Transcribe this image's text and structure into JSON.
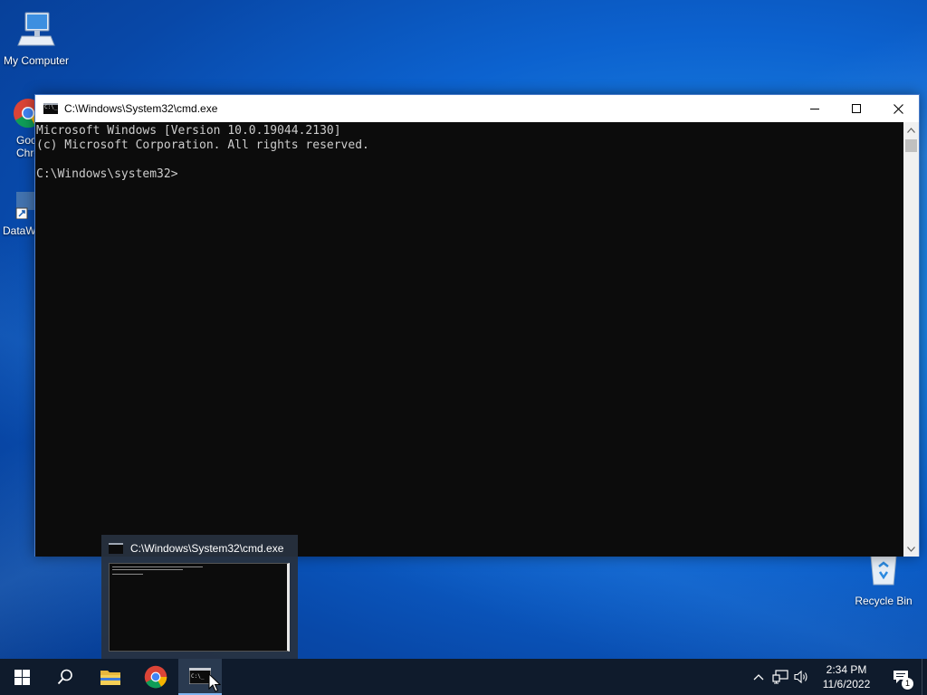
{
  "desktop": {
    "icons": [
      {
        "label": "My Computer",
        "icon": "computer-icon"
      },
      {
        "label": "Goo Chro",
        "icon": "chrome-icon"
      },
      {
        "label": "DataW",
        "icon": "datawrapper-icon"
      }
    ],
    "recycle_bin": {
      "label": "Recycle Bin",
      "icon": "recycle-bin-icon"
    }
  },
  "cmd_window": {
    "title": "C:\\Windows\\System32\\cmd.exe",
    "lines": [
      "Microsoft Windows [Version 10.0.19044.2130]",
      "(c) Microsoft Corporation. All rights reserved.",
      "",
      "C:\\Windows\\system32>"
    ],
    "buttons": {
      "minimize": "minimize-icon",
      "maximize": "maximize-icon",
      "close": "close-icon"
    }
  },
  "taskbar_preview": {
    "title": "C:\\Windows\\System32\\cmd.exe"
  },
  "taskbar": {
    "buttons": [
      {
        "name": "start",
        "icon": "windows-logo-icon"
      },
      {
        "name": "search",
        "icon": "search-icon"
      },
      {
        "name": "file-explorer",
        "icon": "folder-icon"
      },
      {
        "name": "chrome",
        "icon": "chrome-icon"
      },
      {
        "name": "cmd",
        "icon": "cmd-icon",
        "active": true
      }
    ],
    "tray": {
      "time": "2:34 PM",
      "date": "11/6/2022",
      "notification_count": "1"
    }
  },
  "colors": {
    "console_bg": "#0c0c0c",
    "console_text": "#cccccc",
    "taskbar_bg": "#0f1b2c",
    "accent": "#0c62cf"
  }
}
